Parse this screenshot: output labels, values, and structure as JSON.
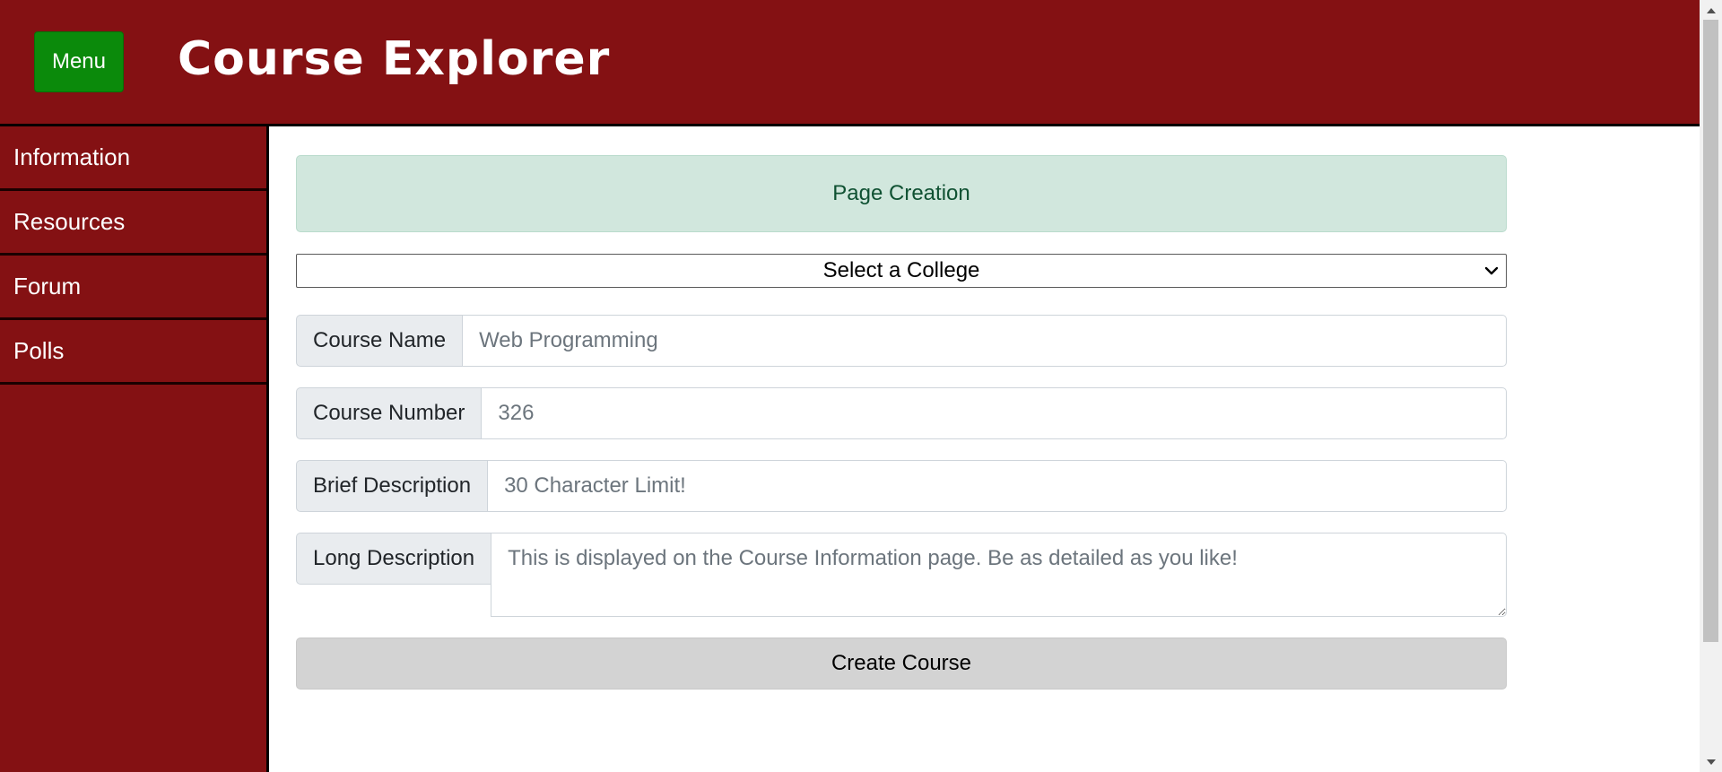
{
  "header": {
    "menu_label": "Menu",
    "title": "Course Explorer"
  },
  "sidebar": {
    "items": [
      {
        "label": "Information"
      },
      {
        "label": "Resources"
      },
      {
        "label": "Forum"
      },
      {
        "label": "Polls"
      }
    ]
  },
  "main": {
    "alert_text": "Page Creation",
    "college_select": {
      "selected": "Select a College"
    },
    "course_name": {
      "label": "Course Name",
      "value": "",
      "placeholder": "Web Programming"
    },
    "course_number": {
      "label": "Course Number",
      "value": "",
      "placeholder": "326"
    },
    "brief_description": {
      "label": "Brief Description",
      "value": "",
      "placeholder": "30 Character Limit!"
    },
    "long_description": {
      "label": "Long Description",
      "value": "",
      "placeholder": "This is displayed on the Course Information page. Be as detailed as you like!"
    },
    "create_button_label": "Create Course"
  },
  "colors": {
    "brand": "#841113",
    "menu_button": "#0b8a0b",
    "alert_bg": "#d1e7dd",
    "alert_text": "#0f5132",
    "create_button": "#d3d3d3"
  },
  "icons": {
    "select_chevron": "chevron-down-icon",
    "scroll_up": "scroll-up-arrow-icon",
    "scroll_down": "scroll-down-arrow-icon"
  }
}
